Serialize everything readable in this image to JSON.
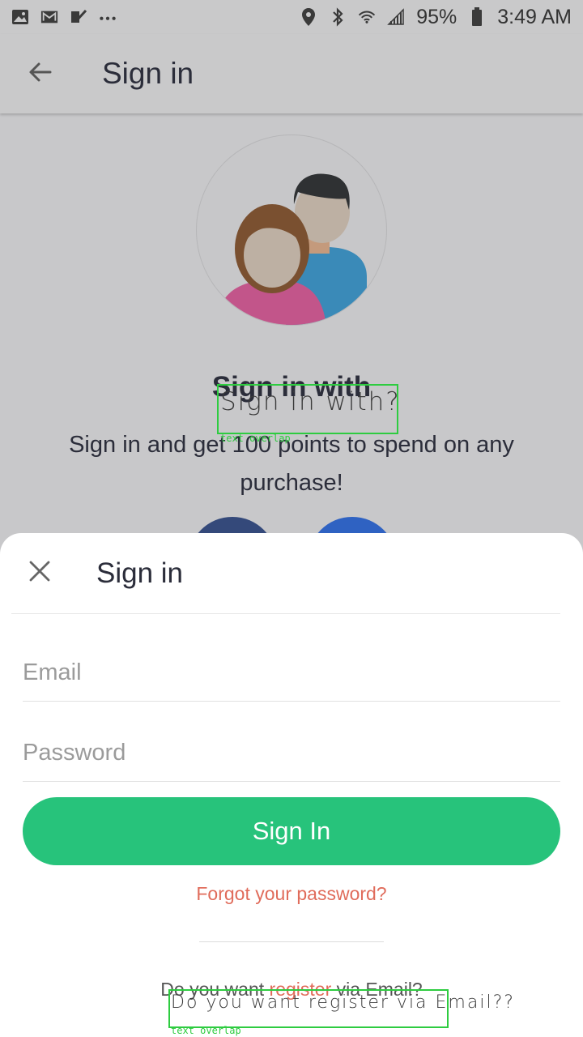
{
  "status_bar": {
    "battery": "95%",
    "time": "3:49 AM",
    "left_icons": [
      "gallery-icon",
      "mail-icon",
      "check-app-icon",
      "more-dots-icon"
    ],
    "right_icons": [
      "location-icon",
      "bluetooth-icon",
      "wifi-icon",
      "signal-icon",
      "battery-icon"
    ]
  },
  "app_bar": {
    "title": "Sign in",
    "back_icon": "back-arrow-icon"
  },
  "background": {
    "heading": "Sign in with",
    "description": "Sign in and get 100 points to spend on any purchase!"
  },
  "annotations": [
    {
      "text": "Sign in with?",
      "label": "text overlap"
    },
    {
      "text": "Do you want register via Email??",
      "label": "text overlap"
    }
  ],
  "sheet": {
    "title": "Sign in",
    "close_icon": "close-icon",
    "email_placeholder": "Email",
    "password_placeholder": "Password",
    "signin_button": "Sign In",
    "forgot_link": "Forgot your password?",
    "register_prefix": "Do you want ",
    "register_link": "register",
    "register_suffix": " via Email?"
  },
  "colors": {
    "primary_green": "#27c37b",
    "link_red": "#e06c5b",
    "annotation_green": "#2ecc40"
  }
}
